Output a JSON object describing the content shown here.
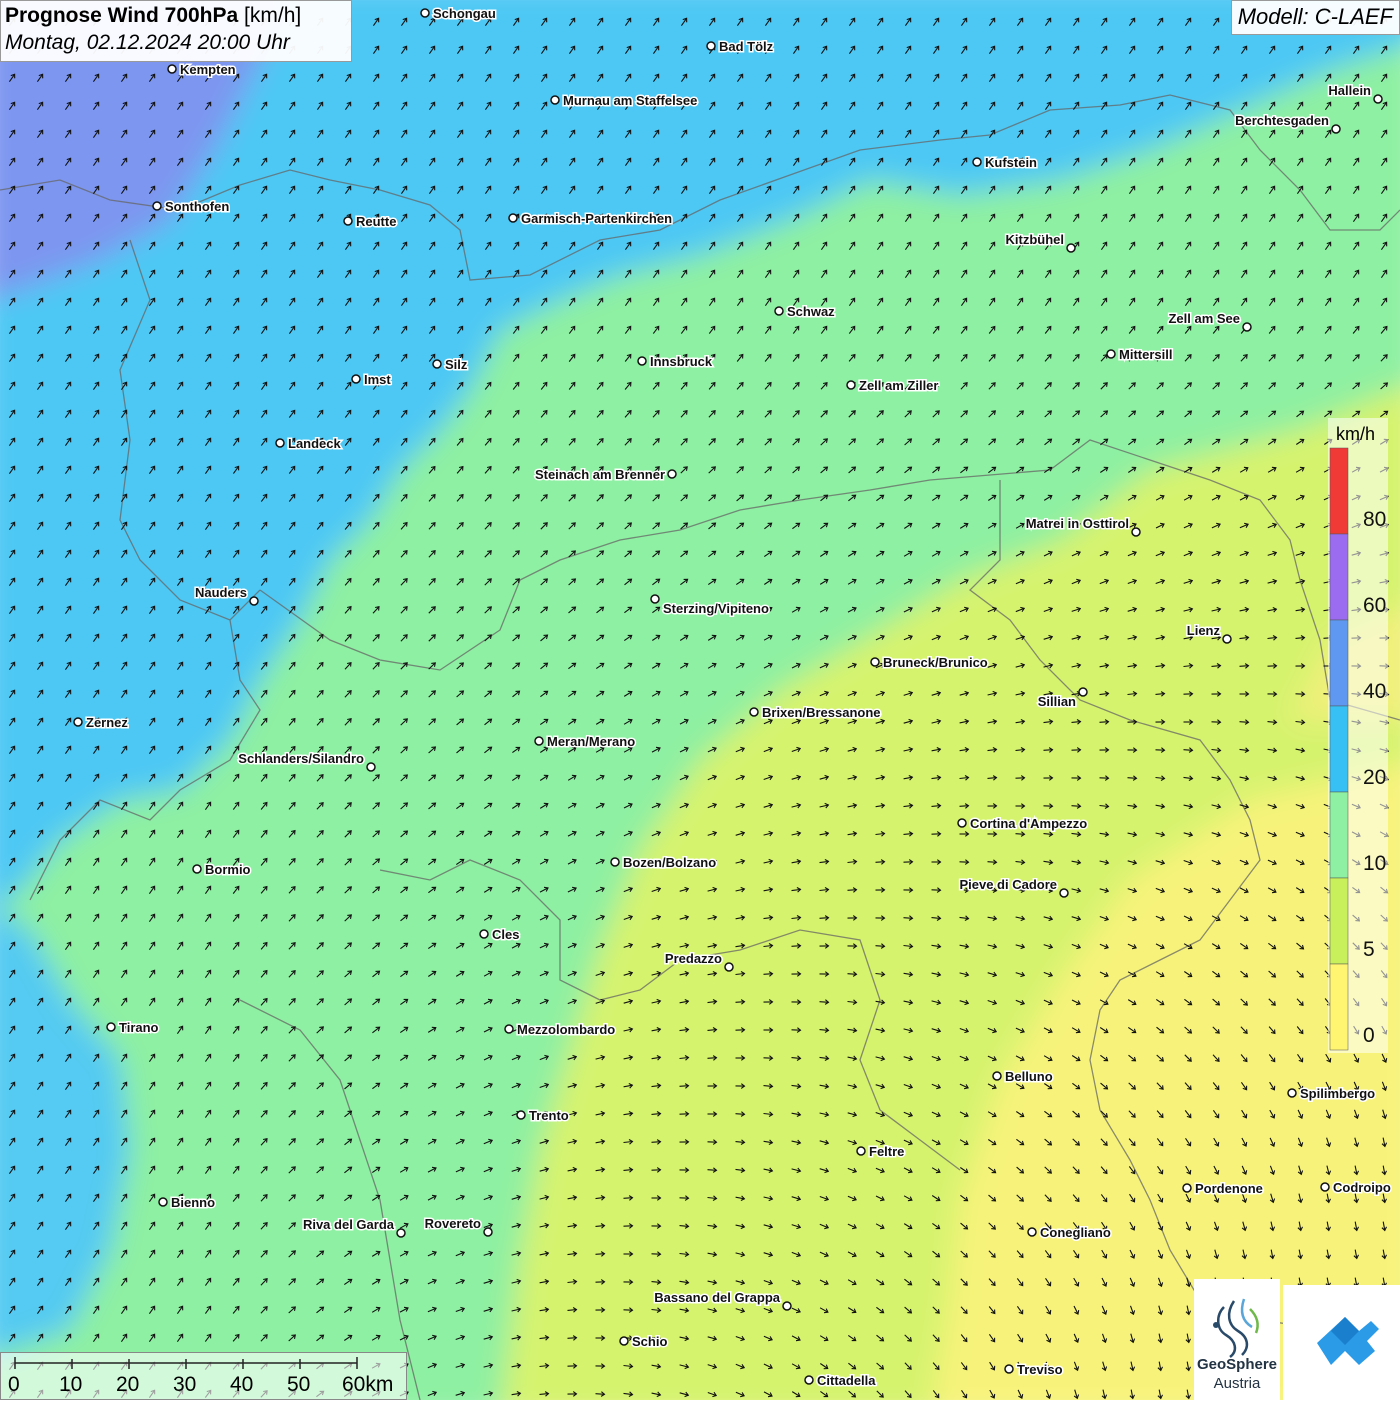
{
  "header": {
    "title_bold": "Prognose Wind 700hPa",
    "title_unit": " [km/h]",
    "subtitle": "Montag, 02.12.2024 20:00 Uhr",
    "model": "Modell: C-LAEF"
  },
  "legend": {
    "unit": "km/h",
    "labels": [
      "80",
      "60",
      "40",
      "20",
      "10",
      "5",
      "0"
    ],
    "colors": [
      "#f03a36",
      "#9b6cf0",
      "#5f98f0",
      "#36c0f4",
      "#8ef0a2",
      "#c8f05a",
      "#fff570"
    ]
  },
  "scale": {
    "labels": [
      "0",
      "10",
      "20",
      "30",
      "40",
      "50",
      "60km"
    ]
  },
  "logo": {
    "brand_line1": "GeoSphere",
    "brand_line2": "Austria"
  },
  "cities": [
    {
      "name": "Schongau"
    },
    {
      "name": "Bad Tölz"
    },
    {
      "name": "Kempten"
    },
    {
      "name": "Murnau am Staffelsee"
    },
    {
      "name": "Hallein"
    },
    {
      "name": "Berchtesgaden"
    },
    {
      "name": "Kufstein"
    },
    {
      "name": "Sonthofen"
    },
    {
      "name": "Reutte"
    },
    {
      "name": "Garmisch-Partenkirchen"
    },
    {
      "name": "Kitzbühel"
    },
    {
      "name": "Schwaz"
    },
    {
      "name": "Zell am See"
    },
    {
      "name": "Innsbruck"
    },
    {
      "name": "Mittersill"
    },
    {
      "name": "Imst"
    },
    {
      "name": "Silz"
    },
    {
      "name": "Zell am Ziller"
    },
    {
      "name": "Landeck"
    },
    {
      "name": "Steinach am Brenner"
    },
    {
      "name": "Matrei in Osttirol"
    },
    {
      "name": "Nauders"
    },
    {
      "name": "Sterzing/Vipiteno"
    },
    {
      "name": "Lienz"
    },
    {
      "name": "Bruneck/Brunico"
    },
    {
      "name": "Sillian"
    },
    {
      "name": "Zernez"
    },
    {
      "name": "Brixen/Bressanone"
    },
    {
      "name": "Meran/Merano"
    },
    {
      "name": "Schlanders/Silandro"
    },
    {
      "name": "Cortina d'Ampezzo"
    },
    {
      "name": "Bormio"
    },
    {
      "name": "Bozen/Bolzano"
    },
    {
      "name": "Pieve di Cadore"
    },
    {
      "name": "Cles"
    },
    {
      "name": "Predazzo"
    },
    {
      "name": "Tirano"
    },
    {
      "name": "Mezzolombardo"
    },
    {
      "name": "Belluno"
    },
    {
      "name": "Spilimbergo"
    },
    {
      "name": "Trento"
    },
    {
      "name": "Feltre"
    },
    {
      "name": "Pordenone"
    },
    {
      "name": "Codroipo"
    },
    {
      "name": "Bienno"
    },
    {
      "name": "Riva del Garda"
    },
    {
      "name": "Rovereto"
    },
    {
      "name": "Conegliano"
    },
    {
      "name": "Bassano del Grappa"
    },
    {
      "name": "Schio"
    },
    {
      "name": "Treviso"
    },
    {
      "name": "Cittadella"
    }
  ]
}
